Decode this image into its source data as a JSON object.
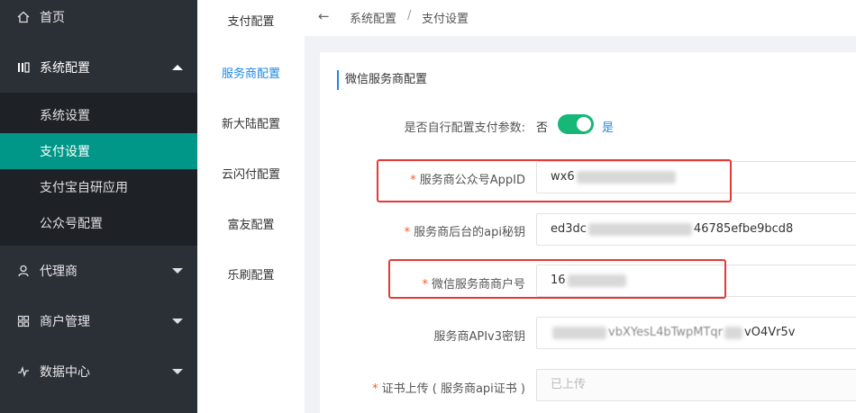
{
  "sidebar": {
    "items": [
      {
        "label": "首页",
        "icon": "home-icon"
      },
      {
        "label": "系统配置",
        "icon": "settings-grid-icon"
      },
      {
        "label": "代理商",
        "icon": "user-icon"
      },
      {
        "label": "商户管理",
        "icon": "grid-icon"
      },
      {
        "label": "数据中心",
        "icon": "chart-line-icon"
      }
    ],
    "submenu": [
      {
        "label": "系统设置"
      },
      {
        "label": "支付设置"
      },
      {
        "label": "支付宝自研应用"
      },
      {
        "label": "公众号配置"
      }
    ]
  },
  "side2": {
    "items": [
      "支付配置",
      "服务商配置",
      "新大陆配置",
      "云闪付配置",
      "富友配置",
      "乐刷配置"
    ]
  },
  "breadcrumb": {
    "level1": "系统配置",
    "separator": "/",
    "level2": "支付设置"
  },
  "form": {
    "section_title": "微信服务商配置",
    "self_config_label": "是否自行配置支付参数:",
    "toggle_no": "否",
    "toggle_yes": "是",
    "toggle_on": true,
    "appid_label": "服务商公众号AppID",
    "appid_value_prefix": "wx6",
    "api_secret_label": "服务商后台的api秘钥",
    "api_secret_prefix": "ed3dc",
    "api_secret_suffix": "46785efbe9bcd8",
    "mch_id_label": "微信服务商商户号",
    "mch_id_prefix": "16",
    "apiv3_label": "服务商APIv3密钥",
    "apiv3_visible": "vbXYesL4bTwpMTqr",
    "apiv3_suffix": "vO4Vr5v",
    "cert_label": "证书上传 ( 服务商api证书 )",
    "cert_placeholder": "已上传"
  },
  "colors": {
    "sidebar_bg": "#2b2f36",
    "active_item": "#009688",
    "accent": "#1e88e5",
    "toggle_on": "#16b777",
    "highlight_box": "#e53935",
    "required": "#ff5722"
  }
}
